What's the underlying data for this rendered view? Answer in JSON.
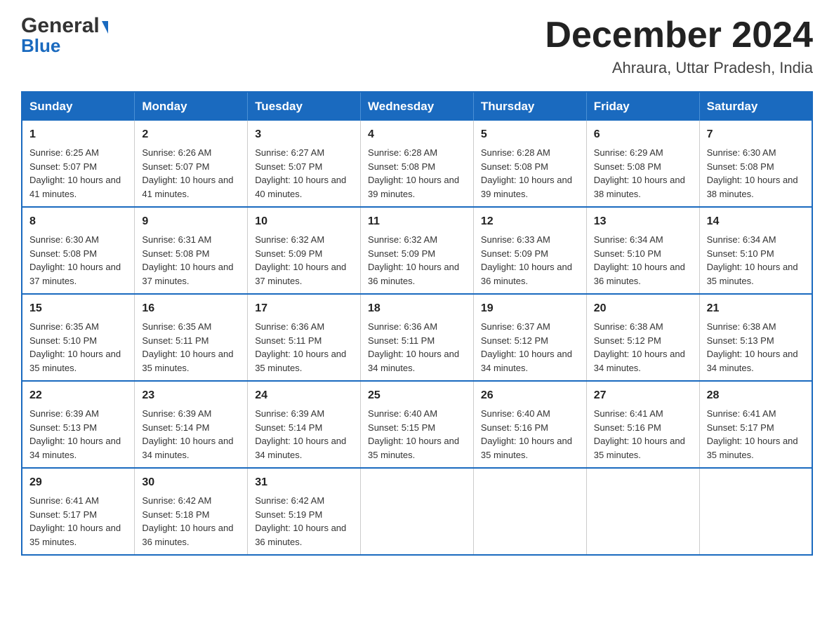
{
  "header": {
    "logo_general": "General",
    "logo_blue": "Blue",
    "month_title": "December 2024",
    "location": "Ahraura, Uttar Pradesh, India"
  },
  "days_of_week": [
    "Sunday",
    "Monday",
    "Tuesday",
    "Wednesday",
    "Thursday",
    "Friday",
    "Saturday"
  ],
  "weeks": [
    [
      {
        "day": "1",
        "sunrise": "6:25 AM",
        "sunset": "5:07 PM",
        "daylight": "10 hours and 41 minutes."
      },
      {
        "day": "2",
        "sunrise": "6:26 AM",
        "sunset": "5:07 PM",
        "daylight": "10 hours and 41 minutes."
      },
      {
        "day": "3",
        "sunrise": "6:27 AM",
        "sunset": "5:07 PM",
        "daylight": "10 hours and 40 minutes."
      },
      {
        "day": "4",
        "sunrise": "6:28 AM",
        "sunset": "5:08 PM",
        "daylight": "10 hours and 39 minutes."
      },
      {
        "day": "5",
        "sunrise": "6:28 AM",
        "sunset": "5:08 PM",
        "daylight": "10 hours and 39 minutes."
      },
      {
        "day": "6",
        "sunrise": "6:29 AM",
        "sunset": "5:08 PM",
        "daylight": "10 hours and 38 minutes."
      },
      {
        "day": "7",
        "sunrise": "6:30 AM",
        "sunset": "5:08 PM",
        "daylight": "10 hours and 38 minutes."
      }
    ],
    [
      {
        "day": "8",
        "sunrise": "6:30 AM",
        "sunset": "5:08 PM",
        "daylight": "10 hours and 37 minutes."
      },
      {
        "day": "9",
        "sunrise": "6:31 AM",
        "sunset": "5:08 PM",
        "daylight": "10 hours and 37 minutes."
      },
      {
        "day": "10",
        "sunrise": "6:32 AM",
        "sunset": "5:09 PM",
        "daylight": "10 hours and 37 minutes."
      },
      {
        "day": "11",
        "sunrise": "6:32 AM",
        "sunset": "5:09 PM",
        "daylight": "10 hours and 36 minutes."
      },
      {
        "day": "12",
        "sunrise": "6:33 AM",
        "sunset": "5:09 PM",
        "daylight": "10 hours and 36 minutes."
      },
      {
        "day": "13",
        "sunrise": "6:34 AM",
        "sunset": "5:10 PM",
        "daylight": "10 hours and 36 minutes."
      },
      {
        "day": "14",
        "sunrise": "6:34 AM",
        "sunset": "5:10 PM",
        "daylight": "10 hours and 35 minutes."
      }
    ],
    [
      {
        "day": "15",
        "sunrise": "6:35 AM",
        "sunset": "5:10 PM",
        "daylight": "10 hours and 35 minutes."
      },
      {
        "day": "16",
        "sunrise": "6:35 AM",
        "sunset": "5:11 PM",
        "daylight": "10 hours and 35 minutes."
      },
      {
        "day": "17",
        "sunrise": "6:36 AM",
        "sunset": "5:11 PM",
        "daylight": "10 hours and 35 minutes."
      },
      {
        "day": "18",
        "sunrise": "6:36 AM",
        "sunset": "5:11 PM",
        "daylight": "10 hours and 34 minutes."
      },
      {
        "day": "19",
        "sunrise": "6:37 AM",
        "sunset": "5:12 PM",
        "daylight": "10 hours and 34 minutes."
      },
      {
        "day": "20",
        "sunrise": "6:38 AM",
        "sunset": "5:12 PM",
        "daylight": "10 hours and 34 minutes."
      },
      {
        "day": "21",
        "sunrise": "6:38 AM",
        "sunset": "5:13 PM",
        "daylight": "10 hours and 34 minutes."
      }
    ],
    [
      {
        "day": "22",
        "sunrise": "6:39 AM",
        "sunset": "5:13 PM",
        "daylight": "10 hours and 34 minutes."
      },
      {
        "day": "23",
        "sunrise": "6:39 AM",
        "sunset": "5:14 PM",
        "daylight": "10 hours and 34 minutes."
      },
      {
        "day": "24",
        "sunrise": "6:39 AM",
        "sunset": "5:14 PM",
        "daylight": "10 hours and 34 minutes."
      },
      {
        "day": "25",
        "sunrise": "6:40 AM",
        "sunset": "5:15 PM",
        "daylight": "10 hours and 35 minutes."
      },
      {
        "day": "26",
        "sunrise": "6:40 AM",
        "sunset": "5:16 PM",
        "daylight": "10 hours and 35 minutes."
      },
      {
        "day": "27",
        "sunrise": "6:41 AM",
        "sunset": "5:16 PM",
        "daylight": "10 hours and 35 minutes."
      },
      {
        "day": "28",
        "sunrise": "6:41 AM",
        "sunset": "5:17 PM",
        "daylight": "10 hours and 35 minutes."
      }
    ],
    [
      {
        "day": "29",
        "sunrise": "6:41 AM",
        "sunset": "5:17 PM",
        "daylight": "10 hours and 35 minutes."
      },
      {
        "day": "30",
        "sunrise": "6:42 AM",
        "sunset": "5:18 PM",
        "daylight": "10 hours and 36 minutes."
      },
      {
        "day": "31",
        "sunrise": "6:42 AM",
        "sunset": "5:19 PM",
        "daylight": "10 hours and 36 minutes."
      },
      null,
      null,
      null,
      null
    ]
  ]
}
